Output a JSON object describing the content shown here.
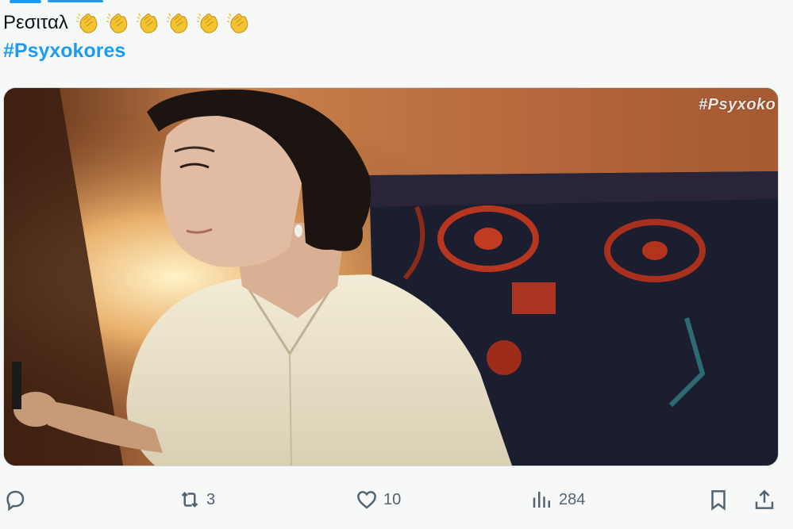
{
  "tweet": {
    "text": "Ρεσιταλ",
    "emoji_count": 6,
    "emoji_icon": "clapping-hands-icon",
    "hashtag": "#Psyxokores"
  },
  "media": {
    "watermark": "#Psyxokores",
    "description_icon": "video-frame"
  },
  "actions": {
    "reply": {
      "icon": "reply-icon",
      "count": ""
    },
    "retweet": {
      "icon": "retweet-icon",
      "count": "3"
    },
    "like": {
      "icon": "heart-icon",
      "count": "10"
    },
    "views": {
      "icon": "views-icon",
      "count": "284"
    },
    "bookmark": {
      "icon": "bookmark-icon"
    },
    "share": {
      "icon": "share-icon"
    }
  },
  "colors": {
    "accent": "#1d9bf0",
    "muted": "#536471",
    "background": "#f7f9f9"
  }
}
